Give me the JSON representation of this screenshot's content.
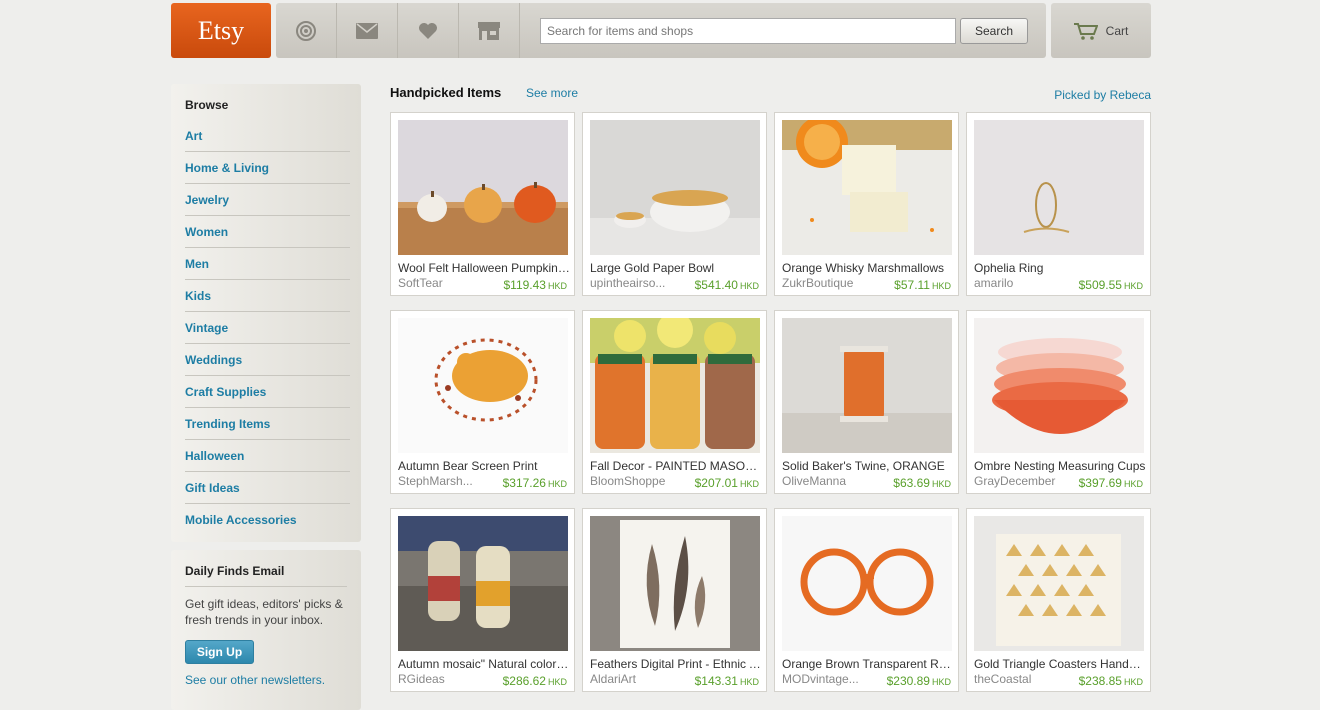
{
  "header": {
    "logo": "Etsy",
    "icons": [
      "activity-icon",
      "mail-icon",
      "favorites-icon",
      "shop-icon"
    ],
    "search_placeholder": "Search for items and shops",
    "search_button": "Search",
    "cart_label": "Cart"
  },
  "sidebar": {
    "heading": "Browse",
    "items": [
      {
        "label": "Art"
      },
      {
        "label": "Home & Living"
      },
      {
        "label": "Jewelry"
      },
      {
        "label": "Women"
      },
      {
        "label": "Men"
      },
      {
        "label": "Kids"
      },
      {
        "label": "Vintage"
      },
      {
        "label": "Weddings"
      },
      {
        "label": "Craft Supplies"
      },
      {
        "label": "Trending Items"
      },
      {
        "label": "Halloween"
      },
      {
        "label": "Gift Ideas"
      },
      {
        "label": "Mobile Accessories"
      }
    ]
  },
  "email_box": {
    "title": "Daily Finds Email",
    "text": "Get gift ideas, editors' picks & fresh trends in your inbox.",
    "button": "Sign Up",
    "link": "See our other newsletters."
  },
  "main": {
    "title": "Handpicked Items",
    "see_more": "See more",
    "picked_by": "Picked by Rebeca",
    "currency": "HKD",
    "items": [
      {
        "title": "Wool Felt Halloween Pumpkin Set",
        "shop": "SoftTear",
        "price": "$119.43"
      },
      {
        "title": "Large Gold Paper Bowl",
        "shop": "upintheairso...",
        "price": "$541.40"
      },
      {
        "title": "Orange Whisky Marshmallows",
        "shop": "ZukrBoutique",
        "price": "$57.11"
      },
      {
        "title": "Ophelia Ring",
        "shop": "amarilo",
        "price": "$509.55"
      },
      {
        "title": "Autumn Bear Screen Print",
        "shop": "StephMarsh...",
        "price": "$317.26"
      },
      {
        "title": "Fall Decor - PAINTED MASON JARS",
        "shop": "BloomShoppe",
        "price": "$207.01"
      },
      {
        "title": "Solid Baker's Twine, ORANGE",
        "shop": "OliveManna",
        "price": "$63.69"
      },
      {
        "title": "Ombre Nesting Measuring Cups",
        "shop": "GrayDecember",
        "price": "$397.69"
      },
      {
        "title": "Autumn mosaic\" Natural colored socks",
        "shop": "RGideas",
        "price": "$286.62"
      },
      {
        "title": "Feathers Digital Print - Ethnic Art",
        "shop": "AldariArt",
        "price": "$143.31"
      },
      {
        "title": "Orange Brown Transparent Round Glasses",
        "shop": "MODvintage...",
        "price": "$230.89"
      },
      {
        "title": "Gold Triangle Coasters Handmade",
        "shop": "theCoastal",
        "price": "$238.85"
      }
    ]
  }
}
